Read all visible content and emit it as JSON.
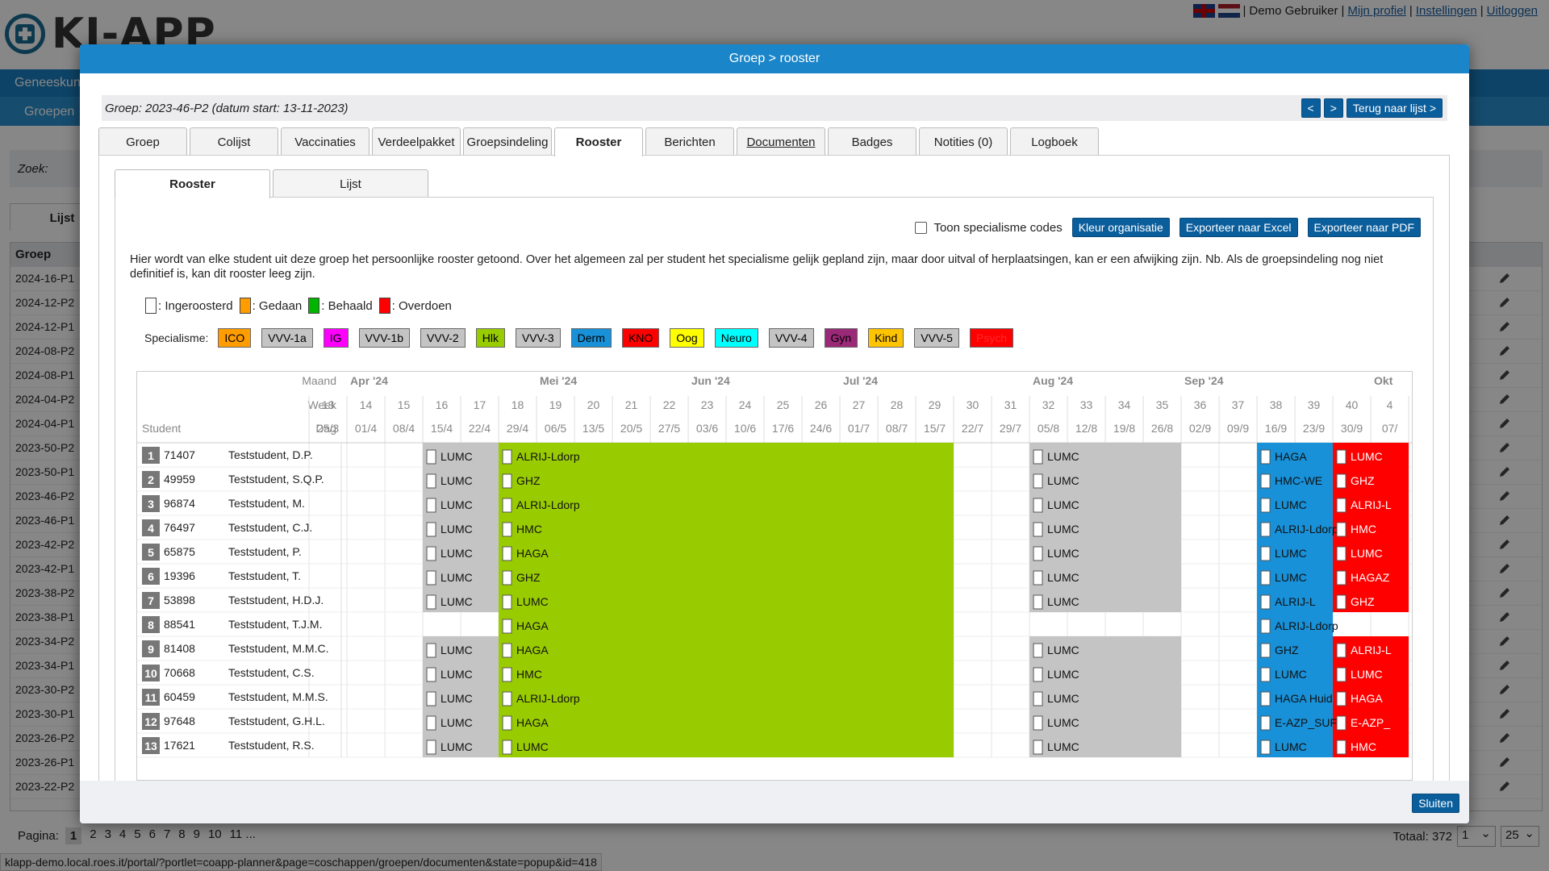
{
  "app": {
    "logo_text": "KI-APP",
    "user_name": "Demo Gebruiker",
    "sep": "|",
    "links": [
      "Mijn profiel",
      "Instellingen",
      "Uitloggen"
    ],
    "nav_label": "Geneeskunde",
    "subnav_label": "Groepen",
    "search_label": "Zoek:",
    "list_tab": "Lijst",
    "group_header": "Groep",
    "groups": [
      "2024-16-P1",
      "2024-12-P2",
      "2024-12-P1",
      "2024-08-P2",
      "2024-08-P1",
      "2024-04-P2",
      "2024-04-P1",
      "2023-50-P2",
      "2023-50-P1",
      "2023-46-P2",
      "2023-46-P1",
      "2023-42-P2",
      "2023-42-P1",
      "2023-38-P2",
      "2023-38-P1",
      "2023-34-P2",
      "2023-34-P1",
      "2023-30-P2",
      "2023-30-P1",
      "2023-26-P2",
      "2023-26-P1",
      "2023-22-P2"
    ],
    "pager_label": "Pagina:",
    "pages": [
      "1",
      "2",
      "3",
      "4",
      "5",
      "6",
      "7",
      "8",
      "9",
      "10",
      "11 ..."
    ],
    "total_label": "Totaal: 372",
    "page_select": "1",
    "size_select": "25",
    "status_url": "klapp-demo.local.roes.it/portal/?portlet=coapp-planner&page=coschappen/groepen/documenten&state=popup&id=418"
  },
  "dialog": {
    "title": "Groep > rooster",
    "group_info": "Groep: 2023-46-P2 (datum start: 13-11-2023)",
    "prev": "<",
    "next": ">",
    "back": "Terug naar lijst >",
    "tabs": [
      "Groep",
      "Colijst",
      "Vaccinaties",
      "Verdeelpakket",
      "Groepsindeling",
      "Rooster",
      "Berichten",
      "Documenten",
      "Badges",
      "Notities (0)",
      "Logboek"
    ],
    "subtabs": [
      "Rooster",
      "Lijst"
    ],
    "show_codes": "Toon specialisme codes",
    "btn_color": "Kleur organisatie",
    "btn_excel": "Exporteer naar Excel",
    "btn_pdf": "Exporteer naar PDF",
    "intro": "Hier wordt van elke student uit deze groep het persoonlijke rooster getoond. Over het algemeen zal per student het specialisme gelijk gepland zijn, maar door uitval of herplaatsingen, kan er een afwijking zijn. Nb. Als de groepsindeling nog niet definitief is, kan dit rooster leeg zijn.",
    "legend": [
      {
        "label": ": Ingeroosterd",
        "color": "#ffffff"
      },
      {
        "label": ": Gedaan",
        "color": "#ff9c00"
      },
      {
        "label": ": Behaald",
        "color": "#00b400"
      },
      {
        "label": ": Overdoen",
        "color": "#ff0000"
      }
    ],
    "spec_label": "Specialisme:",
    "specialisms": [
      {
        "code": "ICO",
        "color": "#ff9c00",
        "text": "#000"
      },
      {
        "code": "VVV-1a",
        "color": "#c4c4c4",
        "text": "#000"
      },
      {
        "code": "IG",
        "color": "#ff00ff",
        "text": "#000"
      },
      {
        "code": "VVV-1b",
        "color": "#c4c4c4",
        "text": "#000"
      },
      {
        "code": "VVV-2",
        "color": "#c4c4c4",
        "text": "#000"
      },
      {
        "code": "Hlk",
        "color": "#99cc00",
        "text": "#000"
      },
      {
        "code": "VVV-3",
        "color": "#c4c4c4",
        "text": "#000"
      },
      {
        "code": "Derm",
        "color": "#1891d8",
        "text": "#000"
      },
      {
        "code": "KNO",
        "color": "#ff0000",
        "text": "#000"
      },
      {
        "code": "Oog",
        "color": "#ffff00",
        "text": "#000"
      },
      {
        "code": "Neuro",
        "color": "#00ffff",
        "text": "#000"
      },
      {
        "code": "VVV-4",
        "color": "#c4c4c4",
        "text": "#000"
      },
      {
        "code": "Gyn",
        "color": "#9a2a78",
        "text": "#000"
      },
      {
        "code": "Kind",
        "color": "#ffc400",
        "text": "#000"
      },
      {
        "code": "VVV-5",
        "color": "#c4c4c4",
        "text": "#000"
      },
      {
        "code": "Psych",
        "color": "#ff0000",
        "text": "#ff2a2a"
      }
    ],
    "close": "Sluiten"
  },
  "schedule": {
    "row_labels": {
      "month": "Maand",
      "week": "Week",
      "day": "Dag",
      "student": "Student"
    },
    "months": [
      {
        "label": "Apr '24",
        "col": 1
      },
      {
        "label": "Mei '24",
        "col": 6
      },
      {
        "label": "Jun '24",
        "col": 10
      },
      {
        "label": "Jul '24",
        "col": 14
      },
      {
        "label": "Aug '24",
        "col": 19
      },
      {
        "label": "Sep '24",
        "col": 23
      },
      {
        "label": "Okt",
        "col": 28
      }
    ],
    "weeks": [
      "13",
      "14",
      "15",
      "16",
      "17",
      "18",
      "19",
      "20",
      "21",
      "22",
      "23",
      "24",
      "25",
      "26",
      "27",
      "28",
      "29",
      "30",
      "31",
      "32",
      "33",
      "34",
      "35",
      "36",
      "37",
      "38",
      "39",
      "40",
      "4"
    ],
    "days": [
      "25/3",
      "01/4",
      "08/4",
      "15/4",
      "22/4",
      "29/4",
      "06/5",
      "13/5",
      "20/5",
      "27/5",
      "03/6",
      "10/6",
      "17/6",
      "24/6",
      "01/7",
      "08/7",
      "15/7",
      "22/7",
      "29/7",
      "05/8",
      "12/8",
      "19/8",
      "26/8",
      "02/9",
      "09/9",
      "16/9",
      "23/9",
      "30/9",
      "07/"
    ],
    "students": [
      {
        "nr": "1",
        "id": "71407",
        "name": "Teststudent, D.P.",
        "blocks": [
          "LUMC",
          "ALRIJ-Ldorp",
          "LUMC",
          "HAGA",
          "LUMC"
        ]
      },
      {
        "nr": "2",
        "id": "49959",
        "name": "Teststudent, S.Q.P.",
        "blocks": [
          "LUMC",
          "GHZ",
          "LUMC",
          "HMC-WE",
          "GHZ"
        ]
      },
      {
        "nr": "3",
        "id": "96874",
        "name": "Teststudent, M.",
        "blocks": [
          "LUMC",
          "ALRIJ-Ldorp",
          "LUMC",
          "LUMC",
          "ALRIJ-L"
        ]
      },
      {
        "nr": "4",
        "id": "76497",
        "name": "Teststudent, C.J.",
        "blocks": [
          "LUMC",
          "HMC",
          "LUMC",
          "ALRIJ-Ldorp",
          "HMC"
        ]
      },
      {
        "nr": "5",
        "id": "65875",
        "name": "Teststudent, P.",
        "blocks": [
          "LUMC",
          "HAGA",
          "LUMC",
          "LUMC",
          "LUMC"
        ]
      },
      {
        "nr": "6",
        "id": "19396",
        "name": "Teststudent, T.",
        "blocks": [
          "LUMC",
          "GHZ",
          "LUMC",
          "LUMC",
          "HAGAZ"
        ]
      },
      {
        "nr": "7",
        "id": "53898",
        "name": "Teststudent, H.D.J.",
        "blocks": [
          "LUMC",
          "LUMC",
          "LUMC",
          "ALRIJ-L",
          "GHZ"
        ]
      },
      {
        "nr": "8",
        "id": "88541",
        "name": "Teststudent, T.J.M.",
        "blocks": [
          "",
          "HAGA",
          "",
          "ALRIJ-Ldorp",
          ""
        ]
      },
      {
        "nr": "9",
        "id": "81408",
        "name": "Teststudent, M.M.C.",
        "blocks": [
          "LUMC",
          "HAGA",
          "LUMC",
          "GHZ",
          "ALRIJ-L"
        ]
      },
      {
        "nr": "10",
        "id": "70668",
        "name": "Teststudent, C.S.",
        "blocks": [
          "LUMC",
          "HMC",
          "LUMC",
          "LUMC",
          "LUMC"
        ]
      },
      {
        "nr": "11",
        "id": "60459",
        "name": "Teststudent, M.M.S.",
        "blocks": [
          "LUMC",
          "ALRIJ-Ldorp",
          "LUMC",
          "HAGA Huid",
          "HAGA"
        ]
      },
      {
        "nr": "12",
        "id": "97648",
        "name": "Teststudent, G.H.L.",
        "blocks": [
          "LUMC",
          "HAGA",
          "LUMC",
          "E-AZP_SUF",
          "E-AZP_"
        ]
      },
      {
        "nr": "13",
        "id": "17621",
        "name": "Teststudent, R.S.",
        "blocks": [
          "LUMC",
          "LUMC",
          "LUMC",
          "LUMC",
          "HMC"
        ]
      }
    ],
    "block_spans": [
      {
        "from": 3,
        "to": 5,
        "color": "#c4c4c4"
      },
      {
        "from": 5,
        "to": 17,
        "color": "#99cc00"
      },
      {
        "from": 19,
        "to": 23,
        "color": "#c4c4c4"
      },
      {
        "from": 25,
        "to": 27,
        "color": "#1891d8"
      },
      {
        "from": 27,
        "to": 29,
        "color": "#ff0000"
      }
    ]
  }
}
